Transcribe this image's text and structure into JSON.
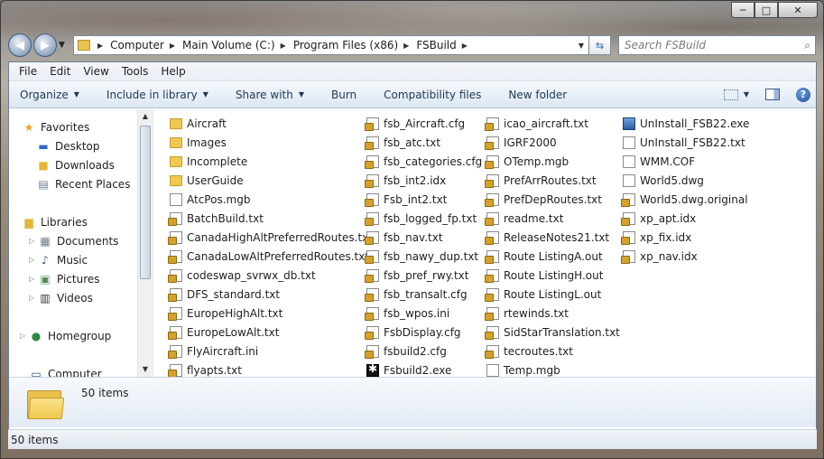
{
  "window": {
    "minimize": "─",
    "maximize": "□",
    "close": "✕"
  },
  "nav": {
    "back": "◀",
    "forward": "▶",
    "history": "▼"
  },
  "address": {
    "crumbs": [
      "Computer",
      "Main Volume (C:)",
      "Program Files (x86)",
      "FSBuild"
    ],
    "refresh": "⇆"
  },
  "search": {
    "placeholder": "Search FSBuild",
    "icon": "search-icon"
  },
  "menu": [
    "File",
    "Edit",
    "View",
    "Tools",
    "Help"
  ],
  "toolbar": {
    "organize": "Organize",
    "include": "Include in library",
    "share": "Share with",
    "burn": "Burn",
    "compat": "Compatibility files",
    "newfolder": "New folder",
    "help": "?"
  },
  "navpane": {
    "favorites": "Favorites",
    "desktop": "Desktop",
    "downloads": "Downloads",
    "recent": "Recent Places",
    "libraries": "Libraries",
    "documents": "Documents",
    "music": "Music",
    "pictures": "Pictures",
    "videos": "Videos",
    "homegroup": "Homegroup",
    "computer": "Computer"
  },
  "files": {
    "col1": [
      {
        "name": "Aircraft",
        "type": "folder"
      },
      {
        "name": "Images",
        "type": "folder"
      },
      {
        "name": "Incomplete",
        "type": "folder"
      },
      {
        "name": "UserGuide",
        "type": "folder"
      },
      {
        "name": "AtcPos.mgb",
        "type": "doc"
      },
      {
        "name": "BatchBuild.txt",
        "type": "locked"
      },
      {
        "name": "CanadaHighAltPreferredRoutes.txt",
        "type": "locked"
      },
      {
        "name": "CanadaLowAltPreferredRoutes.txt",
        "type": "locked"
      },
      {
        "name": "codeswap_svrwx_db.txt",
        "type": "locked"
      },
      {
        "name": "DFS_standard.txt",
        "type": "locked"
      },
      {
        "name": "EuropeHighAlt.txt",
        "type": "locked"
      },
      {
        "name": "EuropeLowAlt.txt",
        "type": "locked"
      },
      {
        "name": "FlyAircraft.ini",
        "type": "locked"
      },
      {
        "name": "flyapts.txt",
        "type": "locked"
      }
    ],
    "col2": [
      {
        "name": "fsb_Aircraft.cfg",
        "type": "locked"
      },
      {
        "name": "fsb_atc.txt",
        "type": "locked"
      },
      {
        "name": "fsb_categories.cfg",
        "type": "locked"
      },
      {
        "name": "fsb_int2.idx",
        "type": "locked"
      },
      {
        "name": "Fsb_int2.txt",
        "type": "locked"
      },
      {
        "name": "fsb_logged_fp.txt",
        "type": "locked"
      },
      {
        "name": "fsb_nav.txt",
        "type": "locked"
      },
      {
        "name": "fsb_nawy_dup.txt",
        "type": "locked"
      },
      {
        "name": "fsb_pref_rwy.txt",
        "type": "locked"
      },
      {
        "name": "fsb_transalt.cfg",
        "type": "locked"
      },
      {
        "name": "fsb_wpos.ini",
        "type": "locked"
      },
      {
        "name": "FsbDisplay.cfg",
        "type": "locked"
      },
      {
        "name": "fsbuild2.cfg",
        "type": "locked"
      },
      {
        "name": "Fsbuild2.exe",
        "type": "exe-dark"
      }
    ],
    "col3": [
      {
        "name": "icao_aircraft.txt",
        "type": "locked"
      },
      {
        "name": "IGRF2000",
        "type": "locked"
      },
      {
        "name": "OTemp.mgb",
        "type": "locked"
      },
      {
        "name": "PrefArrRoutes.txt",
        "type": "locked"
      },
      {
        "name": "PrefDepRoutes.txt",
        "type": "locked"
      },
      {
        "name": "readme.txt",
        "type": "locked"
      },
      {
        "name": "ReleaseNotes21.txt",
        "type": "locked"
      },
      {
        "name": "Route ListingA.out",
        "type": "locked"
      },
      {
        "name": "Route ListingH.out",
        "type": "locked"
      },
      {
        "name": "Route ListingL.out",
        "type": "locked"
      },
      {
        "name": "rtewinds.txt",
        "type": "locked"
      },
      {
        "name": "SidStarTranslation.txt",
        "type": "locked"
      },
      {
        "name": "tecroutes.txt",
        "type": "locked"
      },
      {
        "name": "Temp.mgb",
        "type": "doc"
      }
    ],
    "col4": [
      {
        "name": "UnInstall_FSB22.exe",
        "type": "exe-uninst"
      },
      {
        "name": "UnInstall_FSB22.txt",
        "type": "doc"
      },
      {
        "name": "WMM.COF",
        "type": "doc"
      },
      {
        "name": "World5.dwg",
        "type": "doc"
      },
      {
        "name": "World5.dwg.original",
        "type": "locked"
      },
      {
        "name": "xp_apt.idx",
        "type": "locked"
      },
      {
        "name": "xp_fix.idx",
        "type": "locked"
      },
      {
        "name": "xp_nav.idx",
        "type": "locked"
      }
    ]
  },
  "details": {
    "count": "50 items"
  },
  "status": {
    "text": "50 items"
  }
}
